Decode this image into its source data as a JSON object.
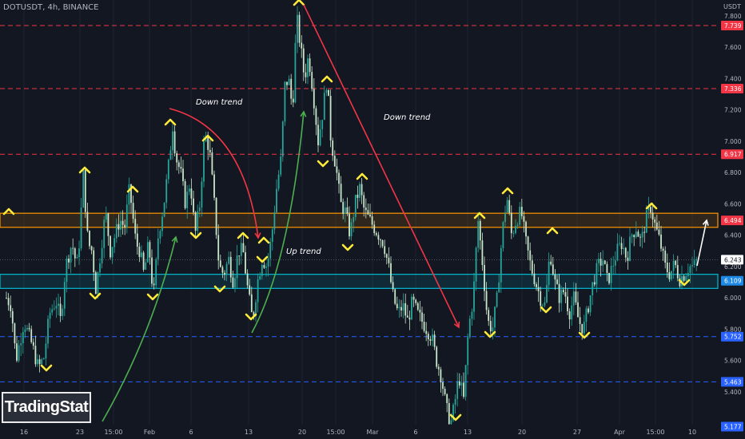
{
  "symbol_line": "DOTUSDT, 4h, BINANCE",
  "currency": "USDT",
  "logo_text": "TradingStat",
  "colors": {
    "background": "#131722",
    "up_candle": "#26a69a",
    "down_candle": "#c8e6c9",
    "resistance_line": "#f23645",
    "support_line": "#2962ff",
    "zone_orange": "#ff9800",
    "zone_cyan": "#00bcd4",
    "marker": "#ffeb3b",
    "arrow_red": "#f23645",
    "arrow_green": "#4caf50"
  },
  "chart_data": {
    "type": "candlestick",
    "y_ticks": [
      "7.800",
      "7.600",
      "7.400",
      "7.200",
      "7.000",
      "6.800",
      "6.600",
      "6.400",
      "6.200",
      "6.000",
      "5.800",
      "5.600",
      "5.400"
    ],
    "x_ticks": [
      "16",
      "23",
      "15:00",
      "Feb",
      "6",
      "13",
      "20",
      "15:00",
      "Mar",
      "6",
      "13",
      "20",
      "27",
      "Apr",
      "15:00",
      "10"
    ],
    "price_labels": [
      {
        "text": "7.739",
        "value": 7.739,
        "color": "#f23645"
      },
      {
        "text": "7.336",
        "value": 7.336,
        "color": "#f23645"
      },
      {
        "text": "6.917",
        "value": 6.917,
        "color": "#f23645"
      },
      {
        "text": "6.494",
        "value": 6.494,
        "color": "#f23645"
      },
      {
        "text": "6.243",
        "value": 6.243,
        "color": "#ffffff"
      },
      {
        "text": "6.109",
        "value": 6.109,
        "color": "#1e88e5"
      },
      {
        "text": "5.752",
        "value": 5.752,
        "color": "#2962ff"
      },
      {
        "text": "5.463",
        "value": 5.463,
        "color": "#2962ff"
      },
      {
        "text": "5.177",
        "value": 5.177,
        "color": "#2962ff"
      }
    ],
    "resistance_levels": [
      7.739,
      7.336,
      6.917
    ],
    "support_levels": [
      5.752,
      5.463
    ],
    "zones": [
      {
        "low": 6.45,
        "high": 6.54,
        "color": "#ff9800"
      },
      {
        "low": 6.06,
        "high": 6.15,
        "color": "#00bcd4"
      }
    ],
    "annotations": [
      "Down trend",
      "Up trend",
      "Down trend"
    ],
    "price_path": [
      [
        0,
        6.0
      ],
      [
        3,
        6.52
      ],
      [
        8,
        6.0
      ],
      [
        14,
        5.95
      ],
      [
        20,
        5.6
      ],
      [
        30,
        5.85
      ],
      [
        40,
        5.7
      ],
      [
        48,
        5.55
      ],
      [
        55,
        5.62
      ],
      [
        62,
        5.9
      ],
      [
        70,
        5.98
      ],
      [
        76,
        5.85
      ],
      [
        82,
        6.2
      ],
      [
        90,
        6.35
      ],
      [
        96,
        6.2
      ],
      [
        100,
        6.4
      ],
      [
        104,
        6.8
      ],
      [
        110,
        6.35
      ],
      [
        115,
        6.3
      ],
      [
        120,
        6.05
      ],
      [
        126,
        6.3
      ],
      [
        132,
        6.55
      ],
      [
        138,
        6.3
      ],
      [
        144,
        6.4
      ],
      [
        150,
        6.5
      ],
      [
        156,
        6.45
      ],
      [
        162,
        6.7
      ],
      [
        170,
        6.35
      ],
      [
        175,
        6.3
      ],
      [
        180,
        6.15
      ],
      [
        186,
        6.35
      ],
      [
        192,
        6.0
      ],
      [
        198,
        6.4
      ],
      [
        205,
        6.6
      ],
      [
        211,
        6.85
      ],
      [
        216,
        7.1
      ],
      [
        220,
        6.9
      ],
      [
        226,
        6.8
      ],
      [
        232,
        6.6
      ],
      [
        238,
        6.75
      ],
      [
        244,
        6.4
      ],
      [
        250,
        6.6
      ],
      [
        256,
        7.05
      ],
      [
        262,
        6.95
      ],
      [
        268,
        6.6
      ],
      [
        274,
        6.2
      ],
      [
        280,
        6.15
      ],
      [
        286,
        6.25
      ],
      [
        292,
        6.1
      ],
      [
        298,
        6.3
      ],
      [
        304,
        6.3
      ],
      [
        310,
        6.05
      ],
      [
        316,
        5.85
      ],
      [
        322,
        6.1
      ],
      [
        328,
        6.25
      ],
      [
        334,
        6.2
      ],
      [
        340,
        6.4
      ],
      [
        346,
        6.7
      ],
      [
        352,
        6.9
      ],
      [
        356,
        7.35
      ],
      [
        361,
        7.4
      ],
      [
        366,
        7.2
      ],
      [
        371,
        7.8
      ],
      [
        376,
        7.6
      ],
      [
        381,
        7.4
      ],
      [
        386,
        7.55
      ],
      [
        392,
        7.3
      ],
      [
        398,
        7.0
      ],
      [
        404,
        7.2
      ],
      [
        409,
        7.4
      ],
      [
        414,
        7.0
      ],
      [
        420,
        6.85
      ],
      [
        426,
        6.6
      ],
      [
        432,
        6.55
      ],
      [
        438,
        6.4
      ],
      [
        444,
        6.6
      ],
      [
        450,
        6.7
      ],
      [
        456,
        6.55
      ],
      [
        462,
        6.5
      ],
      [
        468,
        6.45
      ],
      [
        474,
        6.4
      ],
      [
        480,
        6.35
      ],
      [
        486,
        6.2
      ],
      [
        492,
        6.0
      ],
      [
        498,
        5.9
      ],
      [
        504,
        5.95
      ],
      [
        510,
        5.85
      ],
      [
        516,
        5.98
      ],
      [
        522,
        5.9
      ],
      [
        528,
        5.85
      ],
      [
        534,
        5.8
      ],
      [
        540,
        5.75
      ],
      [
        546,
        5.6
      ],
      [
        552,
        5.5
      ],
      [
        558,
        5.3
      ],
      [
        564,
        5.2
      ],
      [
        568,
        5.3
      ],
      [
        574,
        5.5
      ],
      [
        580,
        5.35
      ],
      [
        586,
        5.8
      ],
      [
        592,
        6.0
      ],
      [
        598,
        6.5
      ],
      [
        604,
        6.2
      ],
      [
        610,
        5.85
      ],
      [
        616,
        5.8
      ],
      [
        622,
        6.0
      ],
      [
        628,
        6.4
      ],
      [
        634,
        6.65
      ],
      [
        640,
        6.4
      ],
      [
        646,
        6.5
      ],
      [
        652,
        6.55
      ],
      [
        658,
        6.35
      ],
      [
        664,
        6.2
      ],
      [
        670,
        6.1
      ],
      [
        676,
        6.0
      ],
      [
        682,
        5.95
      ],
      [
        688,
        6.3
      ],
      [
        694,
        6.1
      ],
      [
        700,
        6.0
      ],
      [
        706,
        6.05
      ],
      [
        712,
        5.9
      ],
      [
        718,
        6.0
      ],
      [
        724,
        5.85
      ],
      [
        730,
        5.8
      ],
      [
        736,
        5.95
      ],
      [
        742,
        6.1
      ],
      [
        748,
        6.2
      ],
      [
        754,
        6.25
      ],
      [
        760,
        6.1
      ],
      [
        766,
        6.2
      ],
      [
        772,
        6.3
      ],
      [
        778,
        6.35
      ],
      [
        784,
        6.25
      ],
      [
        790,
        6.4
      ],
      [
        796,
        6.45
      ],
      [
        802,
        6.35
      ],
      [
        808,
        6.5
      ],
      [
        814,
        6.58
      ],
      [
        820,
        6.45
      ],
      [
        826,
        6.35
      ],
      [
        832,
        6.2
      ],
      [
        838,
        6.15
      ],
      [
        844,
        6.22
      ],
      [
        850,
        6.12
      ],
      [
        856,
        6.15
      ],
      [
        862,
        6.2
      ],
      [
        868,
        6.2
      ],
      [
        872,
        6.24
      ]
    ]
  }
}
